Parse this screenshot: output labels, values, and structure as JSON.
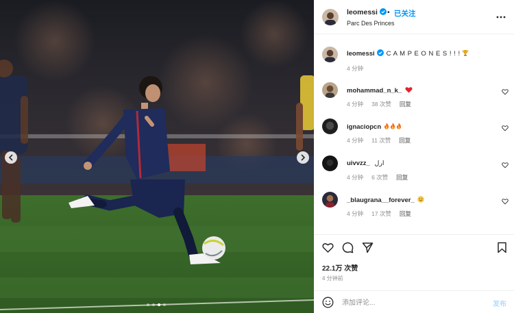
{
  "post": {
    "author": "leomessi",
    "follow_separator": "•",
    "follow_status": "已关注",
    "location": "Parc Des Princes",
    "carousel_slides": 4,
    "carousel_active": 3
  },
  "caption": {
    "user": "leomessi",
    "text": "C A M P E O N E S ! ! !",
    "time": "4 分钟",
    "emoji": "trophy"
  },
  "comments": [
    {
      "user": "mohammad_n_k_",
      "text": "",
      "emoji": "red-heart",
      "time": "4 分钟",
      "likes": "38 次赞",
      "reply": "回复"
    },
    {
      "user": "ignaciopcn",
      "text": "",
      "emoji": "fire-fire-fire",
      "time": "4 分钟",
      "likes": "11 次赞",
      "reply": "回复"
    },
    {
      "user": "uivvzz_",
      "text": "ارل",
      "emoji": "",
      "time": "4 分钟",
      "likes": "6 次赞",
      "reply": "回复"
    },
    {
      "user": "_blaugrana__forever_",
      "text": "",
      "emoji": "slight-smile",
      "time": "4 分钟",
      "likes": "17 次赞",
      "reply": "回复"
    }
  ],
  "stats": {
    "likes": "22.1万 次赞",
    "posted": "4 分钟前"
  },
  "composer": {
    "placeholder": "添加评论...",
    "post_label": "发布"
  },
  "colors": {
    "accent": "#0095f6",
    "post_disabled": "#b3dbff",
    "muted": "#8e8e8e",
    "heart": "#ed4956"
  }
}
